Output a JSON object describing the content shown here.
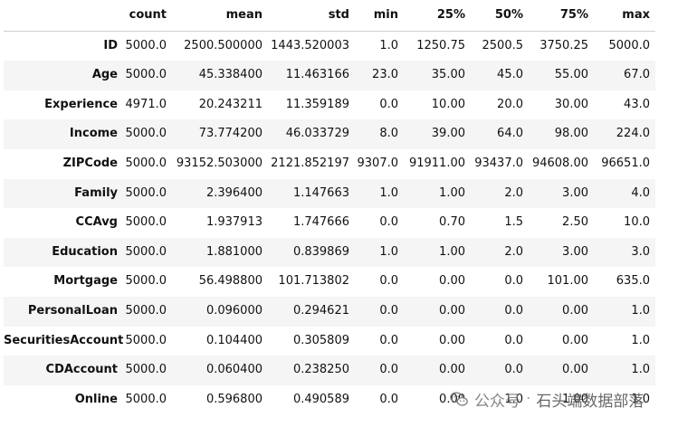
{
  "columns": [
    "",
    "count",
    "mean",
    "std",
    "min",
    "25%",
    "50%",
    "75%",
    "max"
  ],
  "rows": [
    {
      "name": "ID",
      "cells": [
        "5000.0",
        "2500.500000",
        "1443.520003",
        "1.0",
        "1250.75",
        "2500.5",
        "3750.25",
        "5000.0"
      ]
    },
    {
      "name": "Age",
      "cells": [
        "5000.0",
        "45.338400",
        "11.463166",
        "23.0",
        "35.00",
        "45.0",
        "55.00",
        "67.0"
      ]
    },
    {
      "name": "Experience",
      "cells": [
        "4971.0",
        "20.243211",
        "11.359189",
        "0.0",
        "10.00",
        "20.0",
        "30.00",
        "43.0"
      ]
    },
    {
      "name": "Income",
      "cells": [
        "5000.0",
        "73.774200",
        "46.033729",
        "8.0",
        "39.00",
        "64.0",
        "98.00",
        "224.0"
      ]
    },
    {
      "name": "ZIPCode",
      "cells": [
        "5000.0",
        "93152.503000",
        "2121.852197",
        "9307.0",
        "91911.00",
        "93437.0",
        "94608.00",
        "96651.0"
      ]
    },
    {
      "name": "Family",
      "cells": [
        "5000.0",
        "2.396400",
        "1.147663",
        "1.0",
        "1.00",
        "2.0",
        "3.00",
        "4.0"
      ]
    },
    {
      "name": "CCAvg",
      "cells": [
        "5000.0",
        "1.937913",
        "1.747666",
        "0.0",
        "0.70",
        "1.5",
        "2.50",
        "10.0"
      ]
    },
    {
      "name": "Education",
      "cells": [
        "5000.0",
        "1.881000",
        "0.839869",
        "1.0",
        "1.00",
        "2.0",
        "3.00",
        "3.0"
      ]
    },
    {
      "name": "Mortgage",
      "cells": [
        "5000.0",
        "56.498800",
        "101.713802",
        "0.0",
        "0.00",
        "0.0",
        "101.00",
        "635.0"
      ]
    },
    {
      "name": "PersonalLoan",
      "cells": [
        "5000.0",
        "0.096000",
        "0.294621",
        "0.0",
        "0.00",
        "0.0",
        "0.00",
        "1.0"
      ]
    },
    {
      "name": "SecuritiesAccount",
      "cells": [
        "5000.0",
        "0.104400",
        "0.305809",
        "0.0",
        "0.00",
        "0.0",
        "0.00",
        "1.0"
      ]
    },
    {
      "name": "CDAccount",
      "cells": [
        "5000.0",
        "0.060400",
        "0.238250",
        "0.0",
        "0.00",
        "0.0",
        "0.00",
        "1.0"
      ]
    },
    {
      "name": "Online",
      "cells": [
        "5000.0",
        "0.596800",
        "0.490589",
        "0.0",
        "0.00",
        "1.0",
        "1.00",
        "1.0"
      ]
    }
  ],
  "watermark": {
    "platform": "公众号",
    "separator": "·",
    "name": "石头端数据部落",
    "icon": "wechat-icon"
  },
  "colors": {
    "stripe": "#f5f5f5",
    "header_border": "#cfcfcf",
    "text": "#111111",
    "watermark": "#7a7a7a"
  }
}
